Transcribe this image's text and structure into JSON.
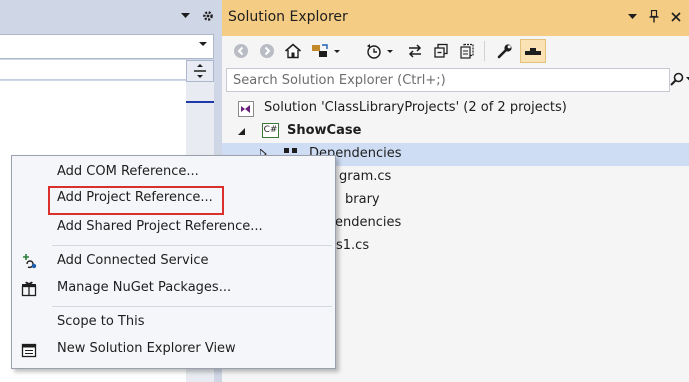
{
  "solution_explorer": {
    "title": "Solution Explorer",
    "search_placeholder": "Search Solution Explorer (Ctrl+;)",
    "toolbar_icons": [
      "back-icon",
      "forward-icon",
      "home-icon",
      "switch-views-icon",
      "history-icon",
      "sync-icon",
      "collapse-all-icon",
      "show-all-files-icon",
      "properties-wrench-icon",
      "preview-icon"
    ],
    "tree": {
      "solution": "Solution 'ClassLibraryProjects' (2 of 2 projects)",
      "project": "ShowCase",
      "project_badge": "C#",
      "dependencies": "Dependencies",
      "program_partial": "gram.cs",
      "library_partial": "brary",
      "dependencies2_partial": "endencies",
      "class1_partial": "s1.cs"
    }
  },
  "context_menu": {
    "items": [
      {
        "label": "Add COM Reference..."
      },
      {
        "label": "Add Project Reference..."
      },
      {
        "label": "Add Shared Project Reference..."
      },
      {
        "label": "Add Connected Service",
        "icon": "connected-service-icon"
      },
      {
        "label": "Manage NuGet Packages...",
        "icon": "nuget-package-icon"
      },
      {
        "label": "Scope to This"
      },
      {
        "label": "New Solution Explorer View",
        "icon": "new-view-icon"
      }
    ]
  },
  "colors": {
    "title_active": "#f5cc84",
    "menu_background": "#f5f6f9",
    "selection": "#cfddf4",
    "highlight_border": "#d9302c",
    "solution_icon": "#68217a"
  }
}
